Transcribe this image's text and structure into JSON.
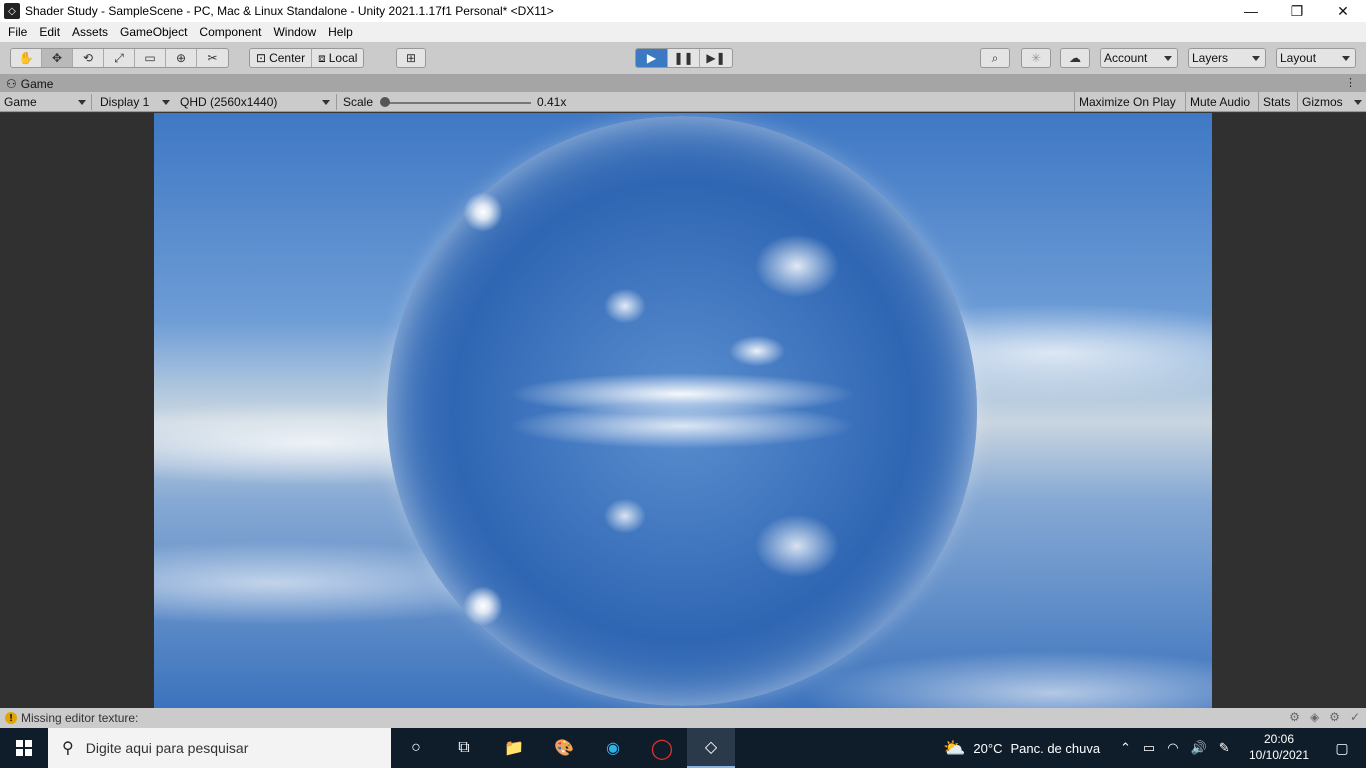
{
  "window": {
    "title": "Shader Study - SampleScene - PC, Mac & Linux Standalone - Unity 2021.1.17f1 Personal* <DX11>",
    "minimize_glyph": "—",
    "restore_glyph": "❐",
    "close_glyph": "✕"
  },
  "menu": [
    "File",
    "Edit",
    "Assets",
    "GameObject",
    "Component",
    "Window",
    "Help"
  ],
  "toolbar": {
    "tools": [
      {
        "name": "hand-tool-icon",
        "glyph": "✋"
      },
      {
        "name": "move-tool-icon",
        "glyph": "✥"
      },
      {
        "name": "rotate-tool-icon",
        "glyph": "⟲"
      },
      {
        "name": "scale-tool-icon",
        "glyph": "⤢"
      },
      {
        "name": "rect-tool-icon",
        "glyph": "▭"
      },
      {
        "name": "transform-tool-icon",
        "glyph": "⊕"
      },
      {
        "name": "custom-tool-icon",
        "glyph": "✂"
      }
    ],
    "active_tool": 1,
    "pivot_label": "Center",
    "space_label": "Local",
    "snap_glyph": "⊞",
    "play_glyph": "▶",
    "pause_glyph": "❚❚",
    "step_glyph": "▶❚",
    "search_glyph": "⌕",
    "services_glyph": "✳",
    "cloud_glyph": "☁",
    "account_label": "Account",
    "layers_label": "Layers",
    "layout_label": "Layout"
  },
  "game_tab": {
    "icon_glyph": "⚇",
    "label": "Game",
    "menu_glyph": "⋮"
  },
  "game_bar": {
    "mode": "Game",
    "display": "Display 1",
    "resolution": "QHD (2560x1440)",
    "scale_label": "Scale",
    "scale_value": "0.41x",
    "scale_fraction": 0.0,
    "toggles": [
      "Maximize On Play",
      "Mute Audio",
      "Stats",
      "Gizmos"
    ]
  },
  "status": {
    "warning_glyph": "!",
    "message": "Missing editor texture:",
    "icons": [
      "⚙",
      "◈",
      "⚙",
      "✓"
    ]
  },
  "taskbar": {
    "search_placeholder": "Digite aqui para pesquisar",
    "search_glyph": "⚲",
    "cortana_glyph": "○",
    "taskview_glyph": "⧉",
    "apps": [
      {
        "name": "file-explorer-icon",
        "glyph": "📁"
      },
      {
        "name": "paint-app-icon",
        "glyph": "🎨"
      },
      {
        "name": "edge-browser-icon",
        "glyph": "◉"
      },
      {
        "name": "opera-browser-icon",
        "glyph": "◯"
      },
      {
        "name": "unity-app-icon",
        "glyph": "◇"
      }
    ],
    "weather_glyph": "⛅",
    "temperature": "20°C",
    "weather_text": "Panc. de chuva",
    "tray_glyphs": [
      "⌃",
      "▭",
      "◠",
      "🔊",
      "✎"
    ],
    "time": "20:06",
    "date": "10/10/2021",
    "notify_glyph": "▢"
  }
}
